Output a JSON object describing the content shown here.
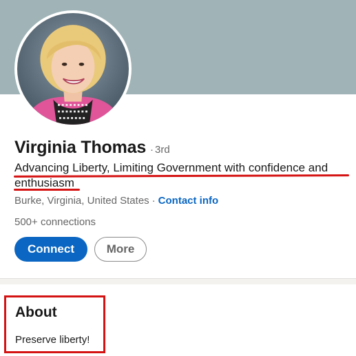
{
  "profile": {
    "name": "Virginia Thomas",
    "degree_separator": "·",
    "degree": "3rd",
    "headline": "Advancing Liberty, Limiting Government with confidence and enthusiasm",
    "location": "Burke, Virginia, United States",
    "location_separator": "·",
    "contact_info_label": "Contact info",
    "connections": "500+ connections"
  },
  "actions": {
    "connect_label": "Connect",
    "more_label": "More"
  },
  "about": {
    "title": "About",
    "text": "Preserve liberty!"
  },
  "colors": {
    "banner": "#a0b4b7",
    "accent_blue": "#0a66c2",
    "annotation_red": "#d51212",
    "divider": "#f3f2ef"
  },
  "icons": {
    "avatar": "profile-photo"
  }
}
